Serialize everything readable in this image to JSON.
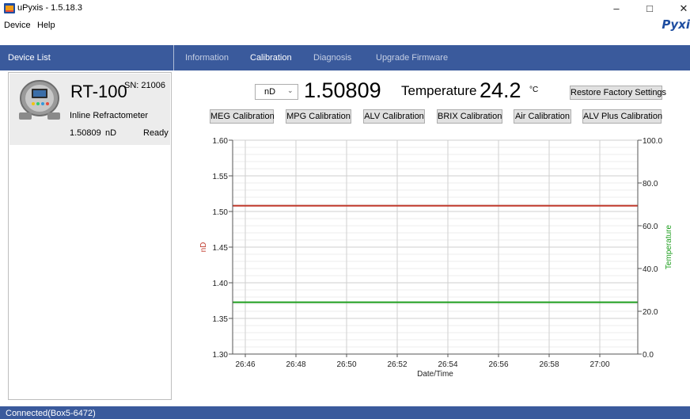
{
  "window": {
    "title": "uPyxis - 1.5.18.3",
    "minimize": "–",
    "maximize": "□",
    "close": "✕",
    "brand": "Pyxi"
  },
  "menu": [
    "Device",
    "Help"
  ],
  "sidebar": {
    "title": "Device List",
    "device": {
      "model": "RT-100",
      "sn": "SN: 21006",
      "type": "Inline Refractometer",
      "value": "1.50809",
      "unit": "nD",
      "status": "Ready"
    }
  },
  "tabs": [
    {
      "label": "Information",
      "active": false
    },
    {
      "label": "Calibration",
      "active": true
    },
    {
      "label": "Diagnosis",
      "active": false
    },
    {
      "label": "Upgrade Firmware",
      "active": false
    }
  ],
  "reading": {
    "unit_select": "nD",
    "nd_value": "1.50809",
    "temp_label": "Temperature",
    "temp_value": "24.2",
    "temp_unit": "°C"
  },
  "buttons": {
    "restore": "Restore Factory Settings",
    "calibrations": [
      "MEG Calibration",
      "MPG Calibration",
      "ALV Calibration",
      "BRIX Calibration",
      "Air Calibration",
      "ALV Plus Calibration"
    ]
  },
  "colors": {
    "header": "#3a5a9c",
    "nd_series": "#c0392b",
    "temp_series": "#1e9e1e"
  },
  "chart_data": {
    "type": "line",
    "xlabel": "Date/Time",
    "ylabel": "nD",
    "y2label": "Temperature",
    "x_ticks": [
      "26:46",
      "26:48",
      "26:50",
      "26:52",
      "26:54",
      "26:56",
      "26:58",
      "27:00"
    ],
    "xlim": [
      "26:45.5",
      "27:01.5"
    ],
    "ylim": [
      1.3,
      1.6
    ],
    "y_ticks": [
      "1.30",
      "1.35",
      "1.40",
      "1.45",
      "1.50",
      "1.55",
      "1.60"
    ],
    "y2lim": [
      0.0,
      100.0
    ],
    "y2_ticks": [
      "0.0",
      "20.0",
      "40.0",
      "60.0",
      "80.0",
      "100.0"
    ],
    "grid": true,
    "series": [
      {
        "axis": "left",
        "x": [
          "26:45.5",
          "27:01.5"
        ],
        "values": [
          1.50809,
          1.50809
        ]
      },
      {
        "axis": "right",
        "x": [
          "26:45.5",
          "27:01.5"
        ],
        "values": [
          24.2,
          24.2
        ]
      }
    ]
  },
  "statusbar": {
    "text": "Connected(Box5-6472)"
  }
}
